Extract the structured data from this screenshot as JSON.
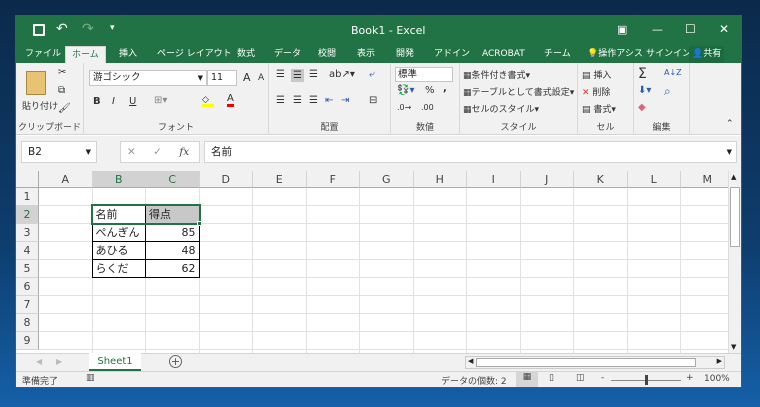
{
  "title": "Book1 - Excel",
  "qat": {
    "save": "save-icon",
    "undo": "↶",
    "redo": "↷"
  },
  "window_controls": {
    "ribbon_display": "▣",
    "minimize": "—",
    "maximize": "☐",
    "close": "✕"
  },
  "tabs": [
    "ファイル",
    "ホーム",
    "挿入",
    "ページ レイアウト",
    "数式",
    "データ",
    "校閲",
    "表示",
    "開発",
    "アドイン",
    "ACROBAT",
    "チーム"
  ],
  "tell_me": "操作アシス",
  "signin": "サインイン",
  "share": "共有",
  "ribbon": {
    "clipboard": {
      "paste": "貼り付け",
      "label": "クリップボード"
    },
    "font": {
      "name": "游ゴシック",
      "size": "11",
      "bold": "B",
      "italic": "I",
      "underline": "U",
      "label": "フォント",
      "grow": "A",
      "shrink": "A",
      "color": "A"
    },
    "alignment": {
      "label": "配置"
    },
    "number": {
      "format": "標準",
      "percent": "%",
      "comma": ",",
      "label": "数値"
    },
    "styles": {
      "conditional": "条件付き書式",
      "table": "テーブルとして書式設定",
      "cell_styles": "セルのスタイル",
      "label": "スタイル"
    },
    "cells": {
      "insert": "挿入",
      "delete": "削除",
      "format": "書式",
      "label": "セル"
    },
    "editing": {
      "sum": "Σ",
      "sort": "A↓Z",
      "find": "⌕",
      "clear": "◆",
      "label": "編集"
    }
  },
  "formula_bar": {
    "name_box": "B2",
    "cancel": "✕",
    "enter": "✓",
    "fx": "fx",
    "value": "名前"
  },
  "columns": [
    "A",
    "B",
    "C",
    "D",
    "E",
    "F",
    "G",
    "H",
    "I",
    "J",
    "K",
    "L",
    "M"
  ],
  "rows": [
    "1",
    "2",
    "3",
    "4",
    "5",
    "6",
    "7",
    "8",
    "9"
  ],
  "cells": [
    {
      "row": 2,
      "col": "B",
      "value": "名前"
    },
    {
      "row": 2,
      "col": "C",
      "value": "得点"
    },
    {
      "row": 3,
      "col": "B",
      "value": "ぺんぎん"
    },
    {
      "row": 3,
      "col": "C",
      "value": "85"
    },
    {
      "row": 4,
      "col": "B",
      "value": "あひる"
    },
    {
      "row": 4,
      "col": "C",
      "value": "48"
    },
    {
      "row": 5,
      "col": "B",
      "value": "らくだ"
    },
    {
      "row": 5,
      "col": "C",
      "value": "62"
    }
  ],
  "sheet_tab": "Sheet1",
  "add_sheet": "+",
  "status": {
    "ready": "準備完了",
    "count": "データの個数: 2",
    "zoom": "100%",
    "zoom_percent": 100
  }
}
